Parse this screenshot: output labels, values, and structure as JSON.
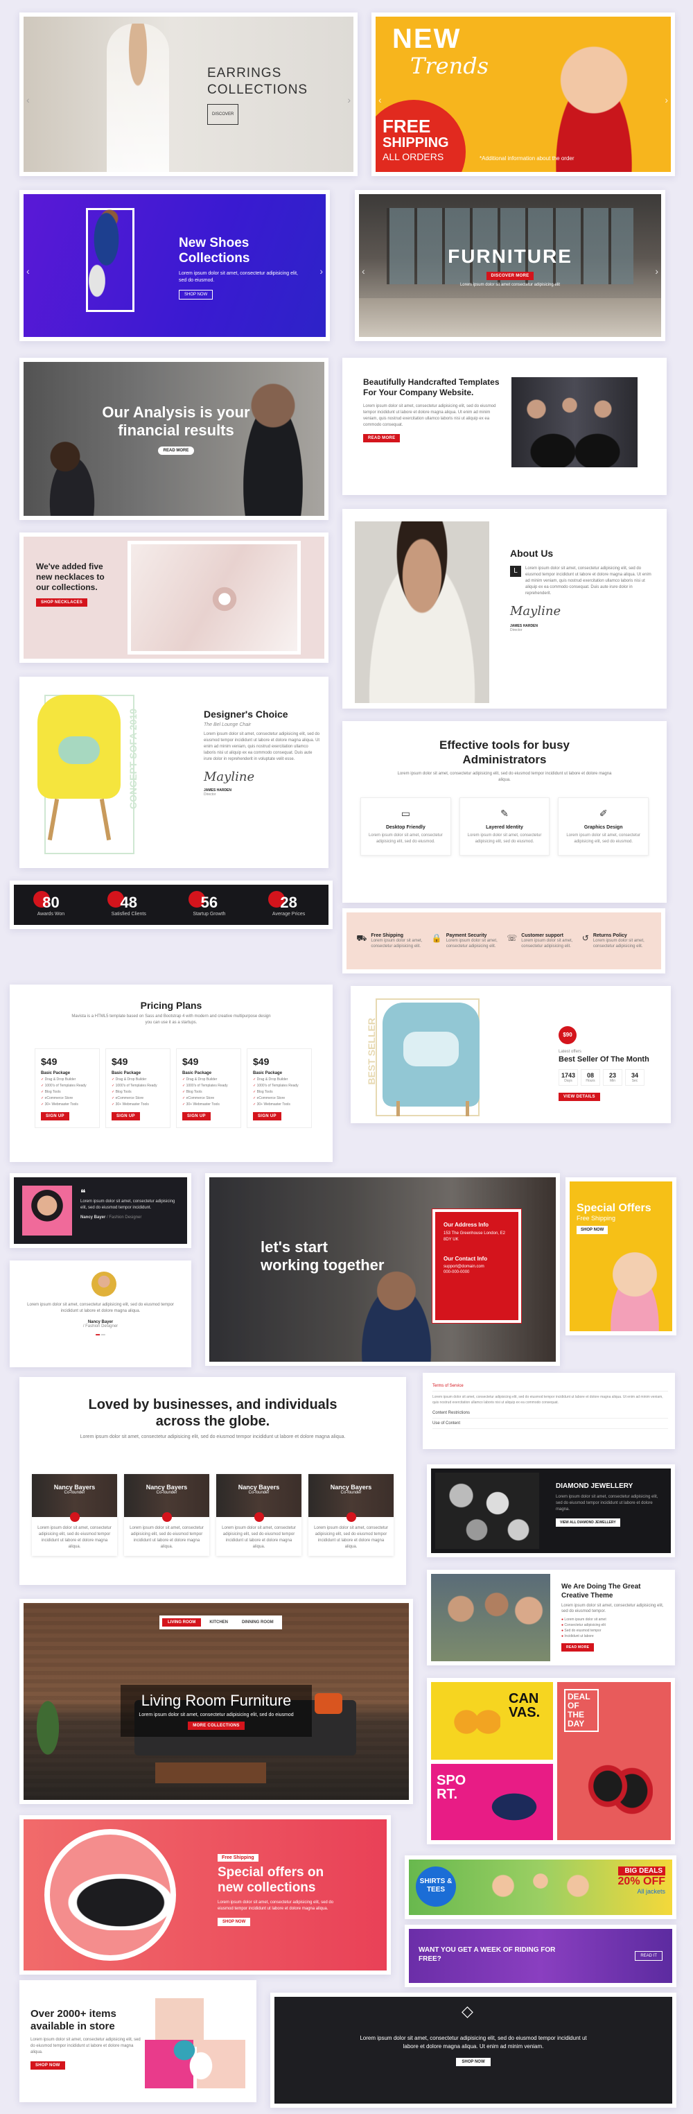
{
  "hero_earrings": {
    "title_1": "EARRINGS",
    "title_2": "COLLECTIONS",
    "btn": "DISCOVER"
  },
  "hero_kids": {
    "line1": "NEW",
    "line2": "Trends",
    "free": "FREE",
    "shipping": "SHIPPING",
    "all_orders": "ALL ORDERS",
    "small": "*Additional information about the order"
  },
  "hero_shoes": {
    "title": "New Shoes Collections",
    "text": "Lorem ipsum dolor sit amet, consectetur adipisicing elit, sed do eiusmod.",
    "btn": "SHOP NOW"
  },
  "hero_furniture": {
    "title": "FURNITURE",
    "btn": "DISCOVER MORE",
    "sub": "Lorem ipsum dolor sit amet consectetur adipisicing elit"
  },
  "analysis": {
    "title": "Our Analysis is your financial results",
    "btn": "READ MORE"
  },
  "templates": {
    "title": "Beautifully Handcrafted Templates For Your Company Website.",
    "text": "Lorem ipsum dolor sit amet, consectetur adipisicing elit, sed do eiusmod tempor incididunt ut labore et dolore magna aliqua. Ut enim ad minim veniam, quis nostrud exercitation ullamco laboris nisi ut aliquip ex ea commodo consequat.",
    "btn": "READ MORE"
  },
  "necklace": {
    "title": "We've added five new necklaces to our collections.",
    "btn": "SHOP NECKLACES"
  },
  "about": {
    "title": "About Us",
    "drop": "L",
    "text": "Lorem ipsum dolor sit amet, consectetur adipisicing elit, sed do eiusmod tempor incididunt ut labore et dolore magna aliqua. Ut enim ad minim veniam, quis nostrud exercitation ullamco laboris nisi ut aliquip ex ea commodo consequat. Duis aute irure dolor in reprehenderit.",
    "sig": "Mayline",
    "name": "JAMES HARDEN",
    "role": "Director"
  },
  "designer": {
    "title": "Designer's Choice",
    "sub": "The Bel Lounge Chair",
    "text": "Lorem ipsum dolor sit amet, consectetur adipisicing elit, sed do eiusmod tempor incididunt ut labore et dolore magna aliqua. Ut enim ad minim veniam, quis nostrud exercitation ullamco laboris nisi ut aliquip ex ea commodo consequat. Duis aute irure dolor in reprehenderit in voluptate velit esse.",
    "sig": "Mayline",
    "name": "JAMES HARDEN",
    "role": "Director",
    "vertical": "CONCEPT SOFA 2019"
  },
  "tools": {
    "title": "Effective tools for busy Administrators",
    "text": "Lorem ipsum dolor sit amet, consectetur adipisicing elit, sed do eiusmod tempor incididunt ut labore et dolore magna aliqua.",
    "items": [
      {
        "icon": "monitor-icon",
        "glyph": "▭",
        "name": "Desktop Friendly",
        "text": "Lorem ipsum dolor sit amet, consectetur adipisicing elit, sed do eiusmod."
      },
      {
        "icon": "pen-icon",
        "glyph": "✎",
        "name": "Layered Identity",
        "text": "Lorem ipsum dolor sit amet, consectetur adipisicing elit, sed do eiusmod."
      },
      {
        "icon": "brush-icon",
        "glyph": "✐",
        "name": "Graphics Design",
        "text": "Lorem ipsum dolor sit amet, consectetur adipisicing elit, sed do eiusmod."
      }
    ]
  },
  "stats": [
    {
      "num": "80",
      "label": "Awards Won"
    },
    {
      "num": "48",
      "label": "Satisfied Clients"
    },
    {
      "num": "56",
      "label": "Startup Growth"
    },
    {
      "num": "28",
      "label": "Average Prices"
    }
  ],
  "features": [
    {
      "icon": "truck-icon",
      "glyph": "⛟",
      "name": "Free Shipping",
      "text": "Lorem ipsum dolor sit amet, consectetur adipisicing elit."
    },
    {
      "icon": "lock-icon",
      "glyph": "🔒",
      "name": "Payment Security",
      "text": "Lorem ipsum dolor sit amet, consectetur adipisicing elit."
    },
    {
      "icon": "support-icon",
      "glyph": "☏",
      "name": "Customer support",
      "text": "Lorem ipsum dolor sit amet, consectetur adipisicing elit."
    },
    {
      "icon": "return-icon",
      "glyph": "↺",
      "name": "Returns Policy",
      "text": "Lorem ipsum dolor sit amet, consectetur adipisicing elit."
    }
  ],
  "pricing": {
    "title": "Pricing Plans",
    "text": "Mavista is a HTML5 template based on Sass and Bootstrap 4 with modern and creative multipurpose design you can use it as a startups.",
    "plans": [
      {
        "price": "$49",
        "name": "Basic Package"
      },
      {
        "price": "$49",
        "name": "Basic Package"
      },
      {
        "price": "$49",
        "name": "Basic Package"
      },
      {
        "price": "$49",
        "name": "Basic Package"
      }
    ],
    "features": [
      "Drag & Drop Builder",
      "1000's of Templates Ready",
      "Blog Tools",
      "eCommerce Store",
      "30+ Webmaster Tools"
    ],
    "btn": "SIGN UP"
  },
  "bestseller": {
    "badge": "$90",
    "sub": "Latest offers",
    "title": "Best Seller Of The Month",
    "countdown": [
      {
        "n": "1743",
        "l": "Days"
      },
      {
        "n": "08",
        "l": "Hours"
      },
      {
        "n": "23",
        "l": "Min"
      },
      {
        "n": "34",
        "l": "Sec"
      }
    ],
    "btn": "VIEW DETAILS",
    "vertical": "BEST SELLER"
  },
  "testimonial_dark": {
    "quote_mark": "❝",
    "text": "Lorem ipsum dolor sit amet, consectetur adipisicing elit, sed do eiusmod tempor incididunt.",
    "name": "Nancy Bayer",
    "role": "/ Fashion Designer"
  },
  "testimonial_light": {
    "text": "Lorem ipsum dolor sit amet, consectetur adipisicing elit, sed do eiusmod tempor incididunt ut labore et dolore magna aliqua.",
    "name": "Nancy Bayer",
    "role": "/ Fashion Designer"
  },
  "working": {
    "title": "let's start working together",
    "addr_title": "Our Address Info",
    "addr": "153 The Greenhouse London, E2 8DY UK",
    "contact_title": "Our Contact Info",
    "email": "support@domain.com",
    "phone": "000-000-0000"
  },
  "special": {
    "title": "Special Offers",
    "sub": "Free Shipping",
    "btn": "SHOP NOW"
  },
  "loved": {
    "title": "Loved by businesses, and individuals across the globe.",
    "text": "Lorem ipsum dolor sit amet, consectetur adipisicing elit, sed do eiusmod tempor incididunt ut labore et dolore magna aliqua.",
    "team": [
      {
        "name": "Nancy Bayers",
        "role": "Co-founder",
        "text": "Lorem ipsum dolor sit amet, consectetur adipisicing elit, sed do eiusmod tempor incididunt ut labore et dolore magna aliqua."
      },
      {
        "name": "Nancy Bayers",
        "role": "Co-founder",
        "text": "Lorem ipsum dolor sit amet, consectetur adipisicing elit, sed do eiusmod tempor incididunt ut labore et dolore magna aliqua."
      },
      {
        "name": "Nancy Bayers",
        "role": "Co-founder",
        "text": "Lorem ipsum dolor sit amet, consectetur adipisicing elit, sed do eiusmod tempor incididunt ut labore et dolore magna aliqua."
      },
      {
        "name": "Nancy Bayers",
        "role": "Co-founder",
        "text": "Lorem ipsum dolor sit amet, consectetur adipisicing elit, sed do eiusmod tempor incididunt ut labore et dolore magna aliqua."
      }
    ]
  },
  "accordion": {
    "items": [
      "Terms of Service",
      "Content Restrictions",
      "Use of Content"
    ],
    "open_text": "Lorem ipsum dolor sit amet, consectetur adipisicing elit, sed do eiusmod tempor incididunt ut labore et dolore magna aliqua. Ut enim ad minim veniam, quis nostrud exercitation ullamco laboris nisi ut aliquip ex ea commodo consequat."
  },
  "jewellery": {
    "title": "DIAMOND JEWELLERY",
    "text": "Lorem ipsum dolor sit amet, consectetur adipisicing elit, sed do eiusmod tempor incididunt ut labore et dolore magna.",
    "btn": "VIEW ALL DIAMOND JEWELLERY"
  },
  "creative": {
    "title": "We Are Doing The Great Creative Theme",
    "text": "Lorem ipsum dolor sit amet, consectetur adipisicing elit, sed do eiusmod tempor.",
    "list": [
      "Lorem ipsum dolor sit amet",
      "Consectetur adipisicing elit",
      "Sed do eiusmod tempor",
      "Incididunt ut labore"
    ],
    "btn": "READ MORE"
  },
  "canvas": {
    "canvas_word": "CAN VAS.",
    "sport_word": "SPO RT.",
    "deal": "DEAL OF THE DAY"
  },
  "living": {
    "tabs": [
      "LIVING ROOM",
      "KITCHEN",
      "DINNING ROOM"
    ],
    "title": "Living Room Furniture",
    "text": "Lorem ipsum dolor sit amet, consectetur adipisicing elit, sed do eiusmod",
    "btn": "MORE COLLECTIONS"
  },
  "offers_shoe": {
    "tag": "Free Shipping",
    "title": "Special offers on new collections",
    "text": "Lorem ipsum dolor sit amet, consectetur adipisicing elit, sed do eiusmod tempor incididunt ut labore et dolore magna aliqua.",
    "btn": "SHOP NOW"
  },
  "shirts": {
    "badge": "SHIRTS & TEES",
    "big": "BIG DEALS",
    "pct": "20% OFF",
    "sub": "All jackets"
  },
  "riding": {
    "title": "WANT YOU GET A WEEK OF RIDING FOR FREE?",
    "btn": "READ IT"
  },
  "items2000": {
    "title": "Over 2000+ items available in store",
    "text": "Lorem ipsum dolor sit amet, consectetur adipisicing elit, sed do eiusmod tempor incididunt ut labore et dolore magna aliqua.",
    "btn": "SHOP NOW"
  },
  "diamond_banner": {
    "text": "Lorem ipsum dolor sit amet, consectetur adipisicing elit, sed do eiusmod tempor incididunt ut labore et dolore magna aliqua. Ut enim ad minim veniam.",
    "btn": "SHOP NOW"
  }
}
